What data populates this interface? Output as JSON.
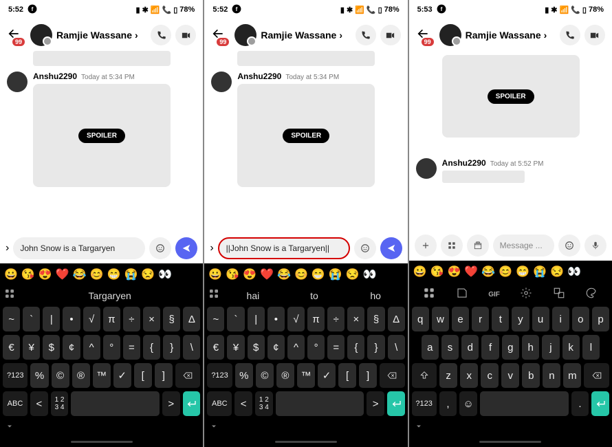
{
  "panels": [
    {
      "status": {
        "time": "5:52",
        "battery": "78%"
      },
      "header": {
        "badge": "99",
        "title": "Ramjie Wassane"
      },
      "messages": [
        {
          "name": "Anshu2290",
          "time": "Today at 5:34 PM",
          "spoiler_label": "SPOILER"
        }
      ],
      "input": {
        "text": "John Snow is a Targaryen"
      },
      "keyboard": {
        "suggestions": {
          "single": "Targaryen"
        },
        "rows": [
          [
            "~",
            "`",
            "|",
            "•",
            "√",
            "π",
            "÷",
            "×",
            "§",
            "Δ"
          ],
          [
            "€",
            "¥",
            "$",
            "¢",
            "^",
            "°",
            "=",
            "{",
            "}",
            "\\"
          ],
          [
            "?123",
            "%",
            "©",
            "®",
            "™",
            "✓",
            "[",
            "]",
            "⌫"
          ],
          [
            "ABC",
            "<",
            "1234",
            "_space_",
            ">",
            "go"
          ]
        ]
      }
    },
    {
      "status": {
        "time": "5:52",
        "battery": "78%"
      },
      "header": {
        "badge": "99",
        "title": "Ramjie Wassane"
      },
      "messages": [
        {
          "name": "Anshu2290",
          "time": "Today at 5:34 PM",
          "spoiler_label": "SPOILER"
        }
      ],
      "input": {
        "text": "||John Snow is a Targaryen||",
        "highlighted": true
      },
      "keyboard": {
        "suggestions": {
          "triple": [
            "hai",
            "to",
            "ho"
          ]
        },
        "rows": [
          [
            "~",
            "`",
            "|",
            "•",
            "√",
            "π",
            "÷",
            "×",
            "§",
            "Δ"
          ],
          [
            "€",
            "¥",
            "$",
            "¢",
            "^",
            "°",
            "=",
            "{",
            "}",
            "\\"
          ],
          [
            "?123",
            "%",
            "©",
            "®",
            "™",
            "✓",
            "[",
            "]",
            "⌫"
          ],
          [
            "ABC",
            "<",
            "1234",
            "_space_",
            ">",
            "go"
          ]
        ]
      }
    },
    {
      "status": {
        "time": "5:53",
        "battery": "78%"
      },
      "header": {
        "badge": "99",
        "title": "Ramjie Wassane"
      },
      "messages": [
        {
          "name": "Anshu2290",
          "time": "Today at 5:52 PM",
          "spoiler_label": "SPOILER",
          "spoiler_first": true
        }
      ],
      "input": {
        "placeholder": "Message ...",
        "alt_layout": true
      },
      "keyboard": {
        "suggestions": {
          "icons": true
        },
        "rows": [
          [
            "q",
            "w",
            "e",
            "r",
            "t",
            "y",
            "u",
            "i",
            "o",
            "p"
          ],
          [
            "a",
            "s",
            "d",
            "f",
            "g",
            "h",
            "j",
            "k",
            "l"
          ],
          [
            "⇧",
            "z",
            "x",
            "c",
            "v",
            "b",
            "n",
            "m",
            "⌫"
          ],
          [
            "?123",
            ",",
            "☺",
            "_space_",
            ".",
            "go"
          ]
        ]
      }
    }
  ],
  "emoji_row": [
    "😀",
    "😘",
    "😍",
    "❤️",
    "😂",
    "😊",
    "😁",
    "😭",
    "😒",
    "👀"
  ]
}
